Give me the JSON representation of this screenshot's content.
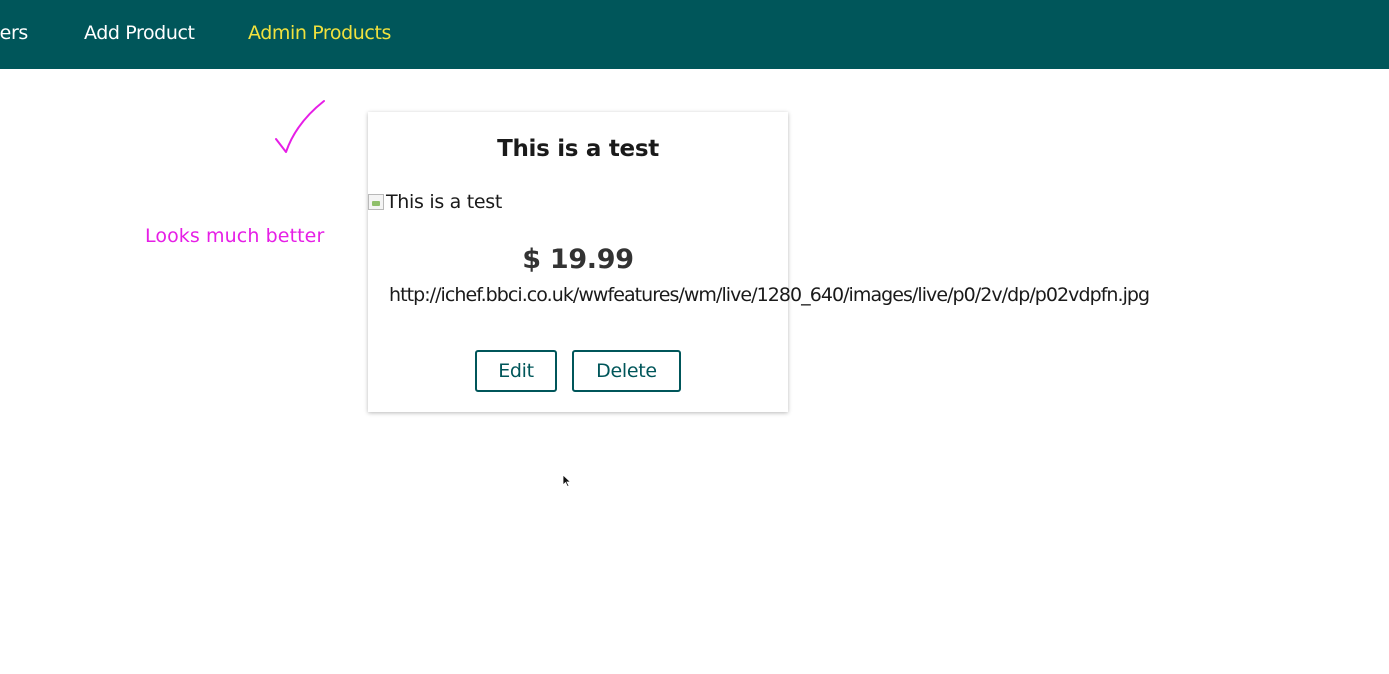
{
  "nav": {
    "items": [
      {
        "label": "ders"
      },
      {
        "label": "Add Product"
      },
      {
        "label": "Admin Products"
      }
    ],
    "active_item": "Admin Products",
    "background_color": "#00565a",
    "active_color": "#f0e13e"
  },
  "product": {
    "title": "This is a test",
    "image_alt": "This is a test",
    "price": "$ 19.99",
    "image_url_text": "http://ichef.bbci.co.uk/wwfeatures/wm/live/1280_640/images/live/p0/2v/dp/p02vdpfn.jpg",
    "edit_label": "Edit",
    "delete_label": "Delete",
    "button_color": "#00565a"
  },
  "annotation": {
    "text": "Looks much better",
    "color": "#e61ee6",
    "mark_icon": "checkmark-icon"
  },
  "cursor_icon": "mouse-pointer-icon"
}
